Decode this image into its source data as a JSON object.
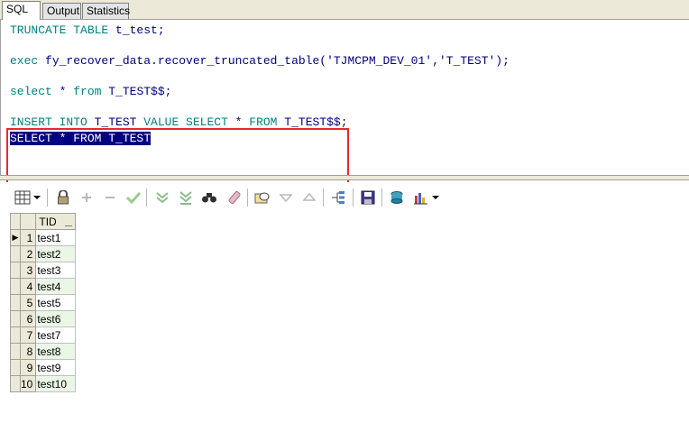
{
  "tabs": [
    {
      "label": "SQL",
      "active": true
    },
    {
      "label": "Output",
      "active": false
    },
    {
      "label": "Statistics",
      "active": false
    }
  ],
  "editor": {
    "line1": {
      "kw": "TRUNCATE TABLE",
      "rest": " t_test;"
    },
    "line2": {
      "kw": "exec",
      "rest": " fy_recover_data.recover_truncated_table('TJMCPM_DEV_01','T_TEST');"
    },
    "line3": {
      "kw": "select",
      "mid": " * ",
      "kw2": "from",
      "rest": " T_TEST$$;"
    },
    "line4": {
      "kw": "INSERT INTO",
      "mid": " T_TEST ",
      "kw2": "VALUE SELECT",
      "mid2": " * ",
      "kw3": "FROM",
      "rest": " T_TEST$$;"
    },
    "line5_selected": "SELECT * FROM T_TEST",
    "highlight_color": "#e8282e"
  },
  "toolbar": {
    "icons": [
      "grid-layout-icon",
      "dropdown-icon",
      "lock-icon",
      "add-record-icon",
      "delete-record-icon",
      "post-changes-icon",
      "fetch-next-icon",
      "fetch-last-icon",
      "find-icon",
      "clear-icon",
      "query-by-example-icon",
      "sort-descending-icon",
      "sort-ascending-icon",
      "hierarchy-icon",
      "save-icon",
      "export-icon",
      "chart-icon",
      "chart-dropdown-icon"
    ]
  },
  "grid": {
    "column": "TID",
    "rows": [
      {
        "n": "1",
        "v": "test1"
      },
      {
        "n": "2",
        "v": "test2"
      },
      {
        "n": "3",
        "v": "test3"
      },
      {
        "n": "4",
        "v": "test4"
      },
      {
        "n": "5",
        "v": "test5"
      },
      {
        "n": "6",
        "v": "test6"
      },
      {
        "n": "7",
        "v": "test7"
      },
      {
        "n": "8",
        "v": "test8"
      },
      {
        "n": "9",
        "v": "test9"
      },
      {
        "n": "10",
        "v": "test10"
      }
    ],
    "current_row_marker": "▶"
  }
}
